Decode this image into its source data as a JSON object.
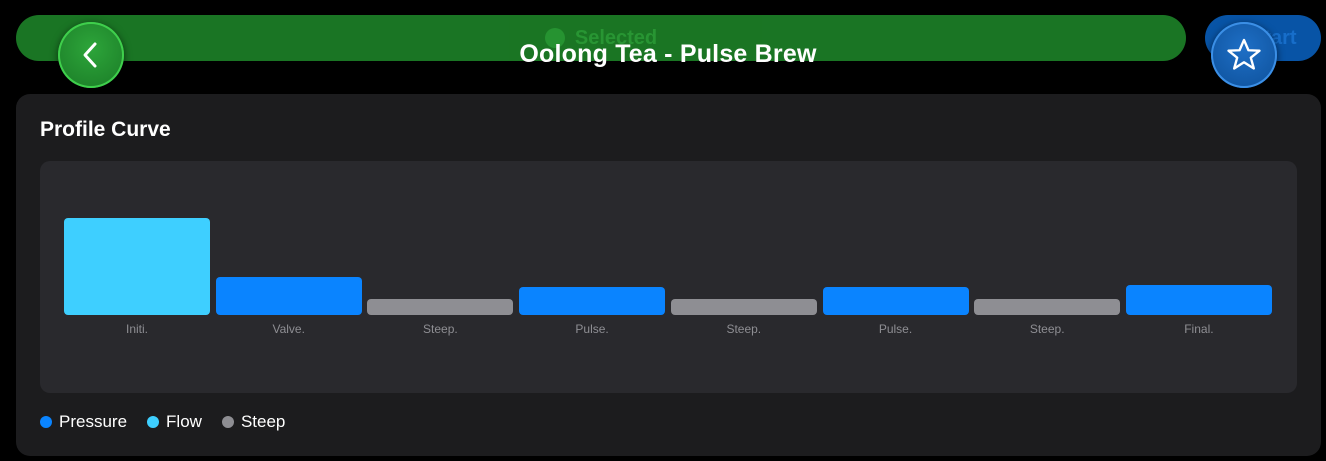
{
  "header": {
    "title": "Oolong Tea - Pulse Brew",
    "banner_label": "Selected",
    "action_label": "Start"
  },
  "card": {
    "title": "Profile Curve"
  },
  "chart_data": {
    "type": "bar",
    "categories": [
      "Initi.",
      "Valve.",
      "Steep.",
      "Pulse.",
      "Steep.",
      "Pulse.",
      "Steep.",
      "Final."
    ],
    "values": [
      1.0,
      0.39,
      0.16,
      0.29,
      0.16,
      0.29,
      0.16,
      0.31
    ],
    "kinds": [
      "Flow",
      "Pressure",
      "Steep",
      "Pressure",
      "Steep",
      "Pressure",
      "Steep",
      "Pressure"
    ],
    "legend": [
      {
        "name": "Pressure",
        "color": "#0a84ff"
      },
      {
        "name": "Flow",
        "color": "#3ecfff"
      },
      {
        "name": "Steep",
        "color": "#8e8e93"
      }
    ]
  },
  "icons": {
    "back": "chevron-left-icon",
    "favorite": "star-icon"
  }
}
